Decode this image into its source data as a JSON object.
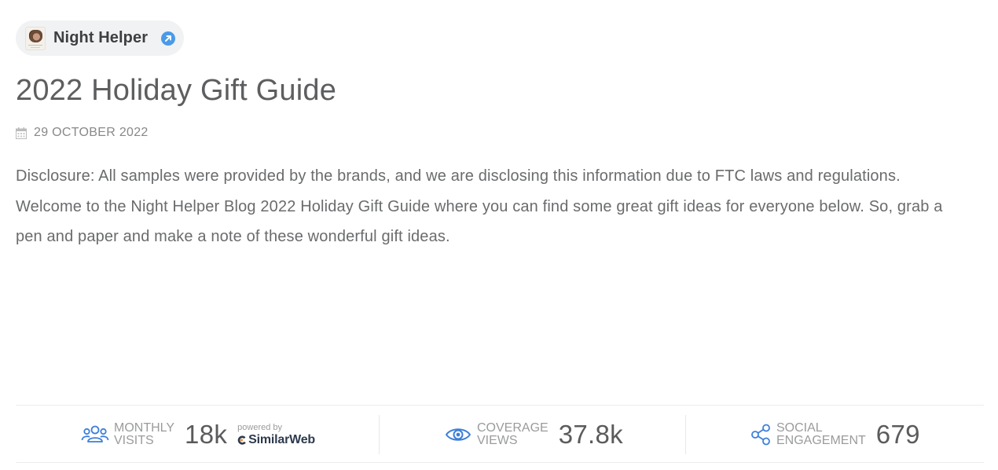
{
  "source": {
    "name": "Night Helper",
    "icon": "external-link-icon",
    "accent": "#4a9ae8"
  },
  "article": {
    "title": "2022 Holiday Gift Guide",
    "date": "29 OCTOBER 2022",
    "excerpt": "Disclosure: All samples were provided by the brands, and we are disclosing this information due to FTC laws and regulations. Welcome to the Night Helper Blog 2022 Holiday Gift Guide where you can find some great gift ideas for everyone below. So, grab a pen and paper and make a note of these wonderful gift ideas."
  },
  "metrics": {
    "monthly": {
      "label_line1": "MONTHLY",
      "label_line2": "VISITS",
      "value": "18k",
      "powered_by": "powered by",
      "provider": "SimilarWeb",
      "icon": "users-icon"
    },
    "coverage": {
      "label_line1": "COVERAGE",
      "label_line2": "VIEWS",
      "value": "37.8k",
      "icon": "eye-icon"
    },
    "social": {
      "label_line1": "SOCIAL",
      "label_line2": "ENGAGEMENT",
      "value": "679",
      "icon": "share-icon"
    },
    "icon_color": "#3d7fd9"
  }
}
